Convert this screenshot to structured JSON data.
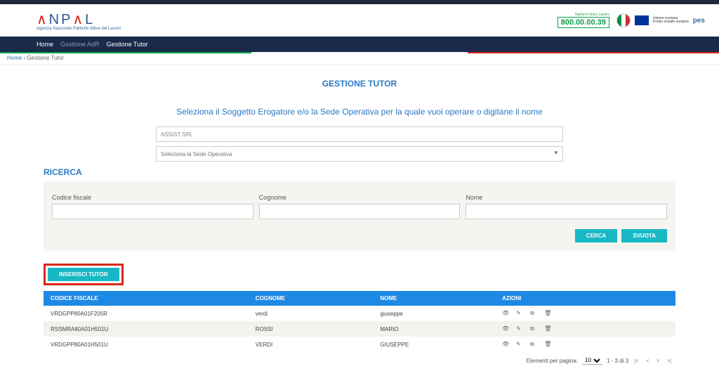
{
  "header": {
    "logo_main": "ANPAL",
    "logo_sub": "Agenzia Nazionale Politiche Attive del Lavoro",
    "phone_label": "Numero Unico Lavoro",
    "phone_number": "800.00.00.39",
    "eu_text1": "Unione europea",
    "eu_text2": "Fondo sociale europeo",
    "pes": "pes"
  },
  "nav": {
    "home": "Home",
    "gest_adr": "Gestione AdR",
    "gest_tutor": "Gestione Tutor"
  },
  "breadcrumb": {
    "home": "Home",
    "sep": " › ",
    "current": "Gestione Tutor"
  },
  "page": {
    "title": "GESTIONE TUTOR",
    "subtitle": "Seleziona il Soggetto Erogatore e/o la Sede Operativa per la quale vuoi operare o digitane il nome",
    "soggetto_value": "ASSIST SRL",
    "sede_placeholder": "Seleziona la Sede Operativa",
    "ricerca": "RICERCA",
    "cf_label": "Codice fiscale",
    "cognome_label": "Cognome",
    "nome_label": "Nome",
    "cerca_btn": "CERCA",
    "svuota_btn": "SVUOTA",
    "insert_btn": "INSERISCI TUTOR"
  },
  "table": {
    "headers": {
      "cf": "CODICE FISCALE",
      "cognome": "COGNOME",
      "nome": "NOME",
      "azioni": "AZIONI"
    },
    "rows": [
      {
        "cf": "VRDGPP80A01F205R",
        "cognome": "verdi",
        "nome": "giuseppe"
      },
      {
        "cf": "RSSMRA80A01H501U",
        "cognome": "ROSSI",
        "nome": "MARIO"
      },
      {
        "cf": "VRDGPP80A01H501U",
        "cognome": "VERDI",
        "nome": "GIUSEPPE"
      }
    ]
  },
  "pagination": {
    "label": "Elementi per pagina:",
    "per_page": "10",
    "range": "1 - 3 di 3"
  }
}
